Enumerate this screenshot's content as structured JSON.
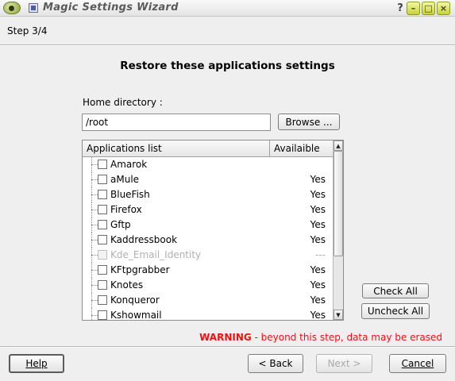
{
  "window": {
    "title": "Magic Settings Wizard",
    "controls": [
      "?",
      "–",
      "□",
      "×"
    ]
  },
  "step": "Step 3/4",
  "heading": "Restore these applications settings",
  "home": {
    "label": "Home directory :",
    "value": "/root",
    "browse": "Browse ..."
  },
  "list": {
    "columns": [
      "Applications list",
      "Availaible"
    ],
    "items": [
      {
        "name": "Amarok",
        "available": "",
        "checked": false,
        "disabled": false
      },
      {
        "name": "aMule",
        "available": "Yes",
        "checked": false,
        "disabled": false
      },
      {
        "name": "BlueFish",
        "available": "Yes",
        "checked": false,
        "disabled": false
      },
      {
        "name": "Firefox",
        "available": "Yes",
        "checked": false,
        "disabled": false
      },
      {
        "name": "Gftp",
        "available": "Yes",
        "checked": false,
        "disabled": false
      },
      {
        "name": "Kaddressbook",
        "available": "Yes",
        "checked": false,
        "disabled": false
      },
      {
        "name": "Kde_Email_Identity",
        "available": "---",
        "checked": false,
        "disabled": true
      },
      {
        "name": "KFtpgrabber",
        "available": "Yes",
        "checked": false,
        "disabled": false
      },
      {
        "name": "Knotes",
        "available": "Yes",
        "checked": false,
        "disabled": false
      },
      {
        "name": "Konqueror",
        "available": "Yes",
        "checked": false,
        "disabled": false
      },
      {
        "name": "Kshowmail",
        "available": "Yes",
        "checked": false,
        "disabled": false
      }
    ]
  },
  "actions": {
    "check_all": "Check All",
    "uncheck_all": "Uncheck All"
  },
  "warning": {
    "strong": "WARNING",
    "rest": " - beyond this step, data may be erased"
  },
  "footer": {
    "help": "Help",
    "back": "< Back",
    "next": "Next >",
    "cancel": "Cancel"
  }
}
